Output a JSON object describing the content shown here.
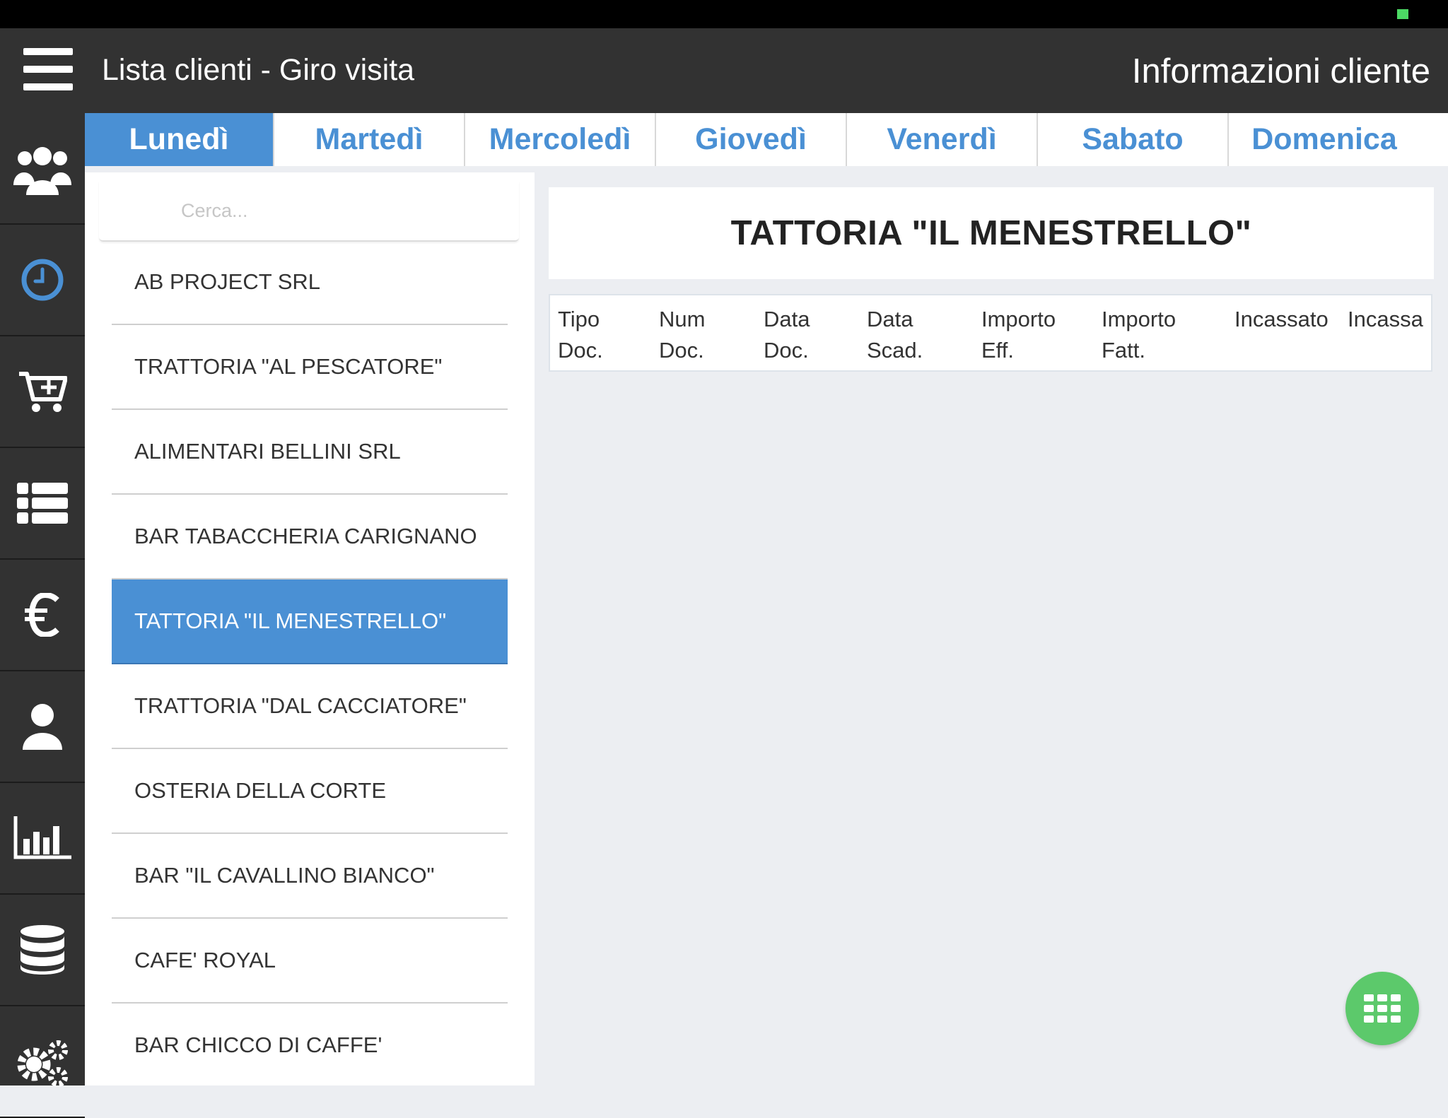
{
  "header": {
    "app_title": "Lista clienti - Giro visita",
    "info_title": "Informazioni cliente"
  },
  "sidebar": {
    "items": [
      {
        "icon": "group-icon",
        "label": "Clienti"
      },
      {
        "icon": "clock-icon",
        "label": "Giro visita",
        "active": true
      },
      {
        "icon": "cart-add-icon",
        "label": "Nuovo ordine"
      },
      {
        "icon": "list-icon",
        "label": "Lista"
      },
      {
        "icon": "euro-icon",
        "label": "Incassi"
      },
      {
        "icon": "user-icon",
        "label": "Utente"
      },
      {
        "icon": "bar-chart-icon",
        "label": "Statistiche"
      },
      {
        "icon": "database-icon",
        "label": "Dati"
      },
      {
        "icon": "gears-icon",
        "label": "Impostazioni"
      }
    ]
  },
  "tabs": [
    {
      "label": "Lunedì",
      "active": true
    },
    {
      "label": "Martedì"
    },
    {
      "label": "Mercoledì"
    },
    {
      "label": "Giovedì"
    },
    {
      "label": "Venerdì"
    },
    {
      "label": "Sabato"
    },
    {
      "label": "Domenica"
    }
  ],
  "search": {
    "placeholder": "Cerca...",
    "value": ""
  },
  "clients": [
    "AB PROJECT SRL",
    "TRATTORIA \"AL PESCATORE\"",
    "ALIMENTARI BELLINI SRL",
    "BAR TABACCHERIA CARIGNANO",
    "TATTORIA \"IL MENESTRELLO\"",
    "TRATTORIA \"DAL CACCIATORE\"",
    "OSTERIA DELLA CORTE",
    "BAR \"IL CAVALLINO BIANCO\"",
    "CAFE' ROYAL",
    "BAR CHICCO DI CAFFE'"
  ],
  "selected_client_index": 4,
  "detail": {
    "client_name": "TATTORIA \"IL MENESTRELLO\"",
    "columns": [
      {
        "line1": "Tipo",
        "line2": "Doc."
      },
      {
        "line1": "Num",
        "line2": "Doc."
      },
      {
        "line1": "Data",
        "line2": "Doc."
      },
      {
        "line1": "Data",
        "line2": "Scad."
      },
      {
        "line1": "Importo",
        "line2": "Eff."
      },
      {
        "line1": "Importo",
        "line2": "Fatt."
      },
      {
        "line1": "Incassato",
        "line2": ""
      },
      {
        "line1": "Incassa",
        "line2": ""
      }
    ],
    "rows": []
  },
  "fab": {
    "icon": "grid-icon"
  },
  "colors": {
    "accent": "#4a90d4",
    "topbar": "#323232",
    "background": "#eceef2",
    "fab": "#5cc96b"
  }
}
